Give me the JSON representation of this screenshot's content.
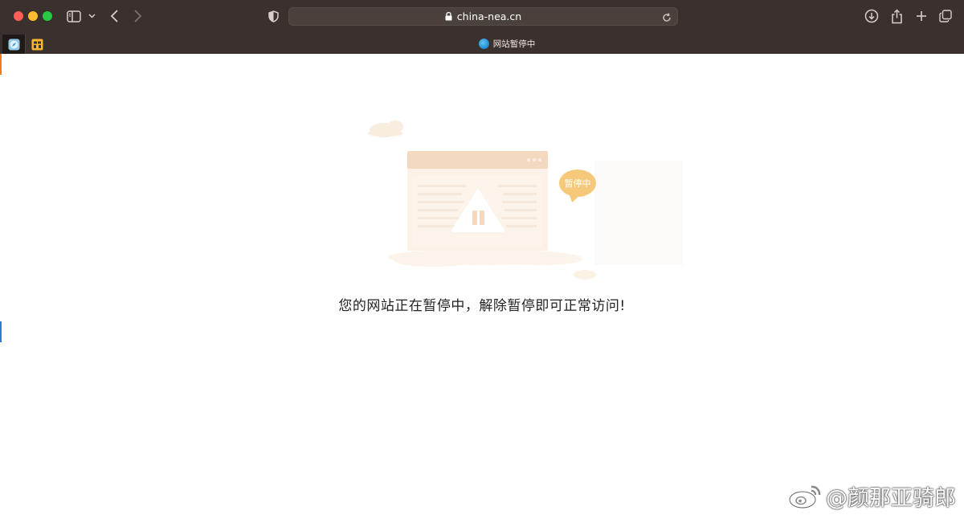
{
  "browser": {
    "url": "china-nea.cn",
    "active_tab_title": "网站暂停中",
    "icons": [
      "sidebar-icon",
      "chevron-down-icon",
      "back-icon",
      "forward-icon",
      "shield-icon",
      "lock-icon",
      "reload-icon",
      "download-icon",
      "share-icon",
      "new-tab-icon",
      "tab-overview-icon"
    ]
  },
  "illustration": {
    "badge": "暂停中",
    "colors": {
      "frame": "#f3d9bf",
      "panel": "#fbf0e3",
      "warning": "#ffffff",
      "badge": "#f6c97a"
    }
  },
  "page": {
    "message": "您的网站正在暂停中，解除暂停即可正常访问!"
  },
  "watermark": {
    "text": "@颜那亚骑郎"
  }
}
